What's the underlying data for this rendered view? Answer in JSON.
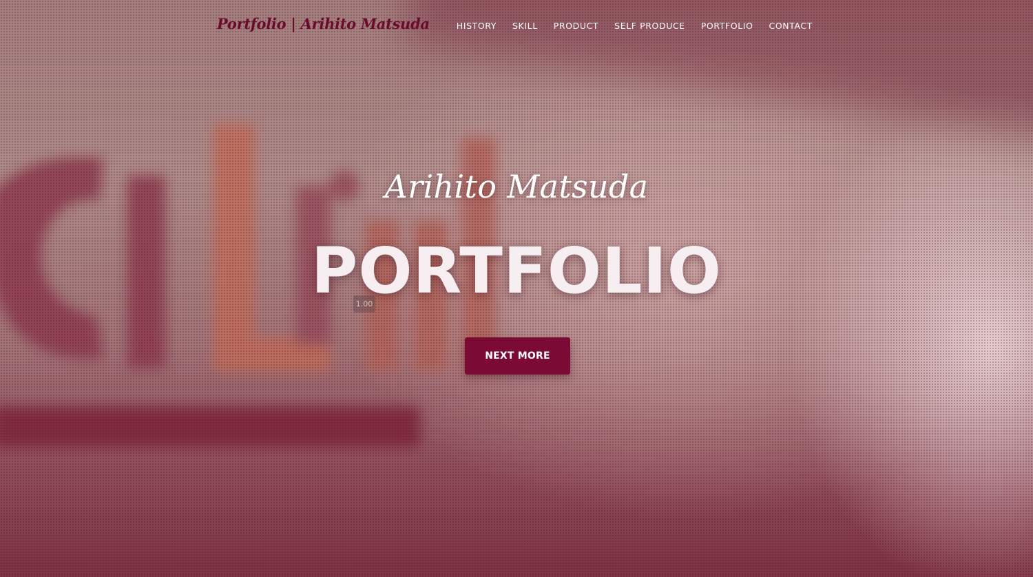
{
  "brand": {
    "title": "Portfolio | Arihito Matsuda"
  },
  "nav": {
    "items": [
      {
        "label": "HISTORY"
      },
      {
        "label": "SKILL"
      },
      {
        "label": "PRODUCT"
      },
      {
        "label": "SELF PRODUCE"
      },
      {
        "label": "PORTFOLIO"
      },
      {
        "label": "CONTACT"
      }
    ]
  },
  "hero": {
    "subtitle": "Arihito Matsuda",
    "title": "PORTFOLIO",
    "zoom_badge": "1.00",
    "button_label": "NEXT MORE",
    "background_image": "blurred office wall with large 3D letters"
  },
  "colors": {
    "accent": "#7b0a35",
    "brand_text": "#6a0b2e",
    "nav_text": "#ffffff"
  }
}
